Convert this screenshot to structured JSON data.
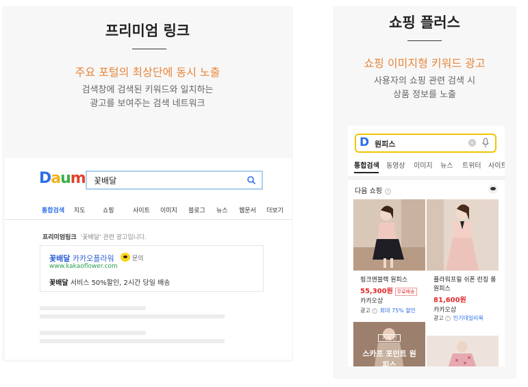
{
  "left": {
    "title": "프리미엄 링크",
    "subtitle": "주요 포털의 최상단에 동시 노출",
    "desc_line1": "검색창에 검색된 키워드와 일치하는",
    "desc_line2": "광고를 보여주는 검색 네트워크",
    "mock": {
      "logo": [
        "D",
        "a",
        "u",
        "m"
      ],
      "query": "꽃배달",
      "tabs": [
        "통합검색",
        "지도",
        "쇼핑",
        "사이트",
        "이미지",
        "블로그",
        "뉴스",
        "웹문서",
        "더보기"
      ],
      "premium_label": "프리미엄링크",
      "premium_note": "'꽃배달' 관련 광고입니다.",
      "ad": {
        "title_bold": "꽃배달",
        "title_rest": " 카카오플라워",
        "inquiry": "문의",
        "url": "www.kakaoflower.com",
        "desc_bold": "꽃배달",
        "desc_rest": " 서비스 50%할인, 2시간 당일 배송"
      }
    }
  },
  "right": {
    "title": "쇼핑 플러스",
    "subtitle": "쇼핑 이미지형 키워드 광고",
    "desc_line1": "사용자의 쇼핑 관련 검색 시",
    "desc_line2": "상품 정보를 노출",
    "mock": {
      "logo": "D",
      "query": "원피스",
      "tabs": [
        "통합검색",
        "동영상",
        "이미지",
        "뉴스",
        "트위터",
        "사이트"
      ],
      "section": "다음 쇼핑",
      "products": [
        {
          "name": "핑크앤블랙 원피스",
          "price": "55,300원",
          "free": "무료배송",
          "seller": "카카오샵",
          "ad": "광고",
          "promo": "최대 75% 할인"
        },
        {
          "name": "플라워프릴 쉬폰 런칭 롱 원피스",
          "price": "81,600원",
          "seller": "카카오샵",
          "ad": "광고",
          "promo": "인기데일리룩"
        }
      ],
      "banner_tag": "기획전",
      "banner_text": "스카프 포인트 원",
      "banner_text2": "피스"
    }
  },
  "colors": {
    "accent": "#e8853a",
    "link": "#2c5dd5",
    "price": "#e02a2a",
    "search_yellow": "#f2c500"
  }
}
